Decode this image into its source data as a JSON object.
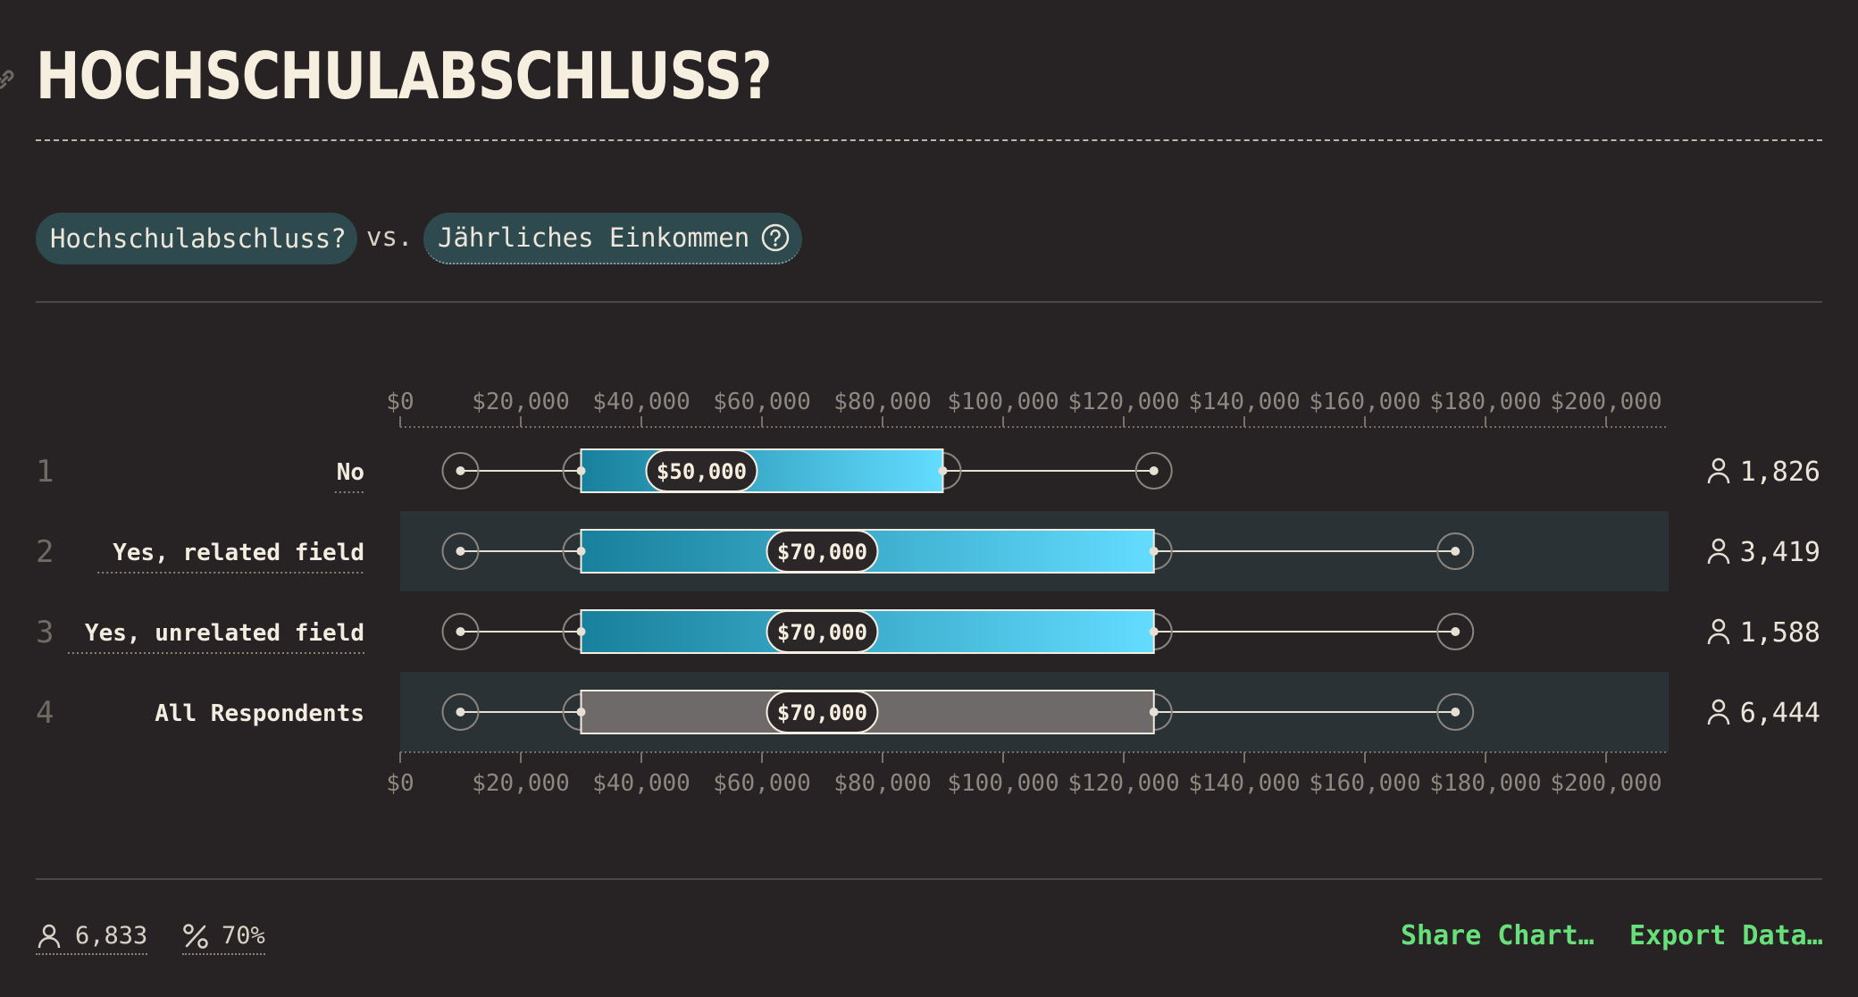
{
  "header": {
    "title": "HOCHSCHULABSCHLUSS?"
  },
  "controls": {
    "x_variable": "Hochschulabschluss?",
    "vs_label": "vs.",
    "y_variable": "Jährliches Einkommen"
  },
  "chart_data": {
    "type": "boxplot",
    "x_axis": {
      "min": 0,
      "max": 210000,
      "ticks": [
        0,
        20000,
        40000,
        60000,
        80000,
        100000,
        120000,
        140000,
        160000,
        180000,
        200000
      ],
      "tick_labels": [
        "$0",
        "$20,000",
        "$40,000",
        "$60,000",
        "$80,000",
        "$100,000",
        "$120,000",
        "$140,000",
        "$160,000",
        "$180,000",
        "$200,000"
      ]
    },
    "rows": [
      {
        "index": "1",
        "label": "No",
        "whisker_low": 10000,
        "q1": 30000,
        "median": 50000,
        "q3": 90000,
        "whisker_high": 125000,
        "median_label": "$50,000",
        "count": "1,826",
        "style": "gradient",
        "shaded": false
      },
      {
        "index": "2",
        "label": "Yes, related field",
        "whisker_low": 10000,
        "q1": 30000,
        "median": 70000,
        "q3": 125000,
        "whisker_high": 175000,
        "median_label": "$70,000",
        "count": "3,419",
        "style": "gradient",
        "shaded": true
      },
      {
        "index": "3",
        "label": "Yes, unrelated field",
        "whisker_low": 10000,
        "q1": 30000,
        "median": 70000,
        "q3": 125000,
        "whisker_high": 175000,
        "median_label": "$70,000",
        "count": "1,588",
        "style": "gradient",
        "shaded": false
      },
      {
        "index": "4",
        "label": "All Respondents",
        "whisker_low": 10000,
        "q1": 30000,
        "median": 70000,
        "q3": 125000,
        "whisker_high": 175000,
        "median_label": "$70,000",
        "count": "6,444",
        "style": "gray",
        "shaded": true
      }
    ],
    "colors": {
      "gradient_start": "#18809c",
      "gradient_end": "#63dcff",
      "gray_box": "#6d6a69",
      "row_shade": "#2a3236"
    }
  },
  "footer": {
    "respondents": "6,833",
    "percent": "70%",
    "share_label": "Share Chart…",
    "export_label": "Export Data…",
    "accent": "#67e07a"
  }
}
